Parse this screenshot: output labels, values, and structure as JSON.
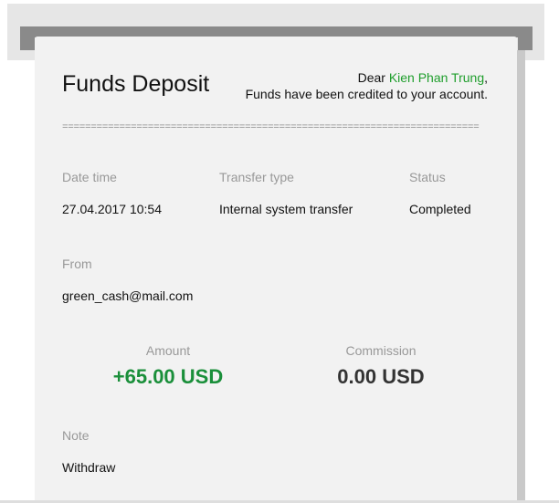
{
  "receipt": {
    "title": "Funds Deposit",
    "greeting_prefix": "Dear ",
    "recipient_name": "Kien Phan Trung",
    "greeting_suffix": ",",
    "message": "Funds have been credited to your account.",
    "divider": "=========================================================================",
    "datetime_label": "Date time",
    "datetime_value": "27.04.2017 10:54",
    "transfer_type_label": "Transfer type",
    "transfer_type_value": "Internal system transfer",
    "status_label": "Status",
    "status_value": "Completed",
    "from_label": "From",
    "from_value": "green_cash@mail.com",
    "amount_label": "Amount",
    "amount_value": "+65.00 USD",
    "commission_label": "Commission",
    "commission_value": "0.00 USD",
    "note_label": "Note",
    "note_value": "Withdraw"
  },
  "colors": {
    "accent_green": "#1f9e2c",
    "amount_green": "#1a8f3a",
    "paper": "#f2f2f2",
    "label_gray": "#999999"
  }
}
